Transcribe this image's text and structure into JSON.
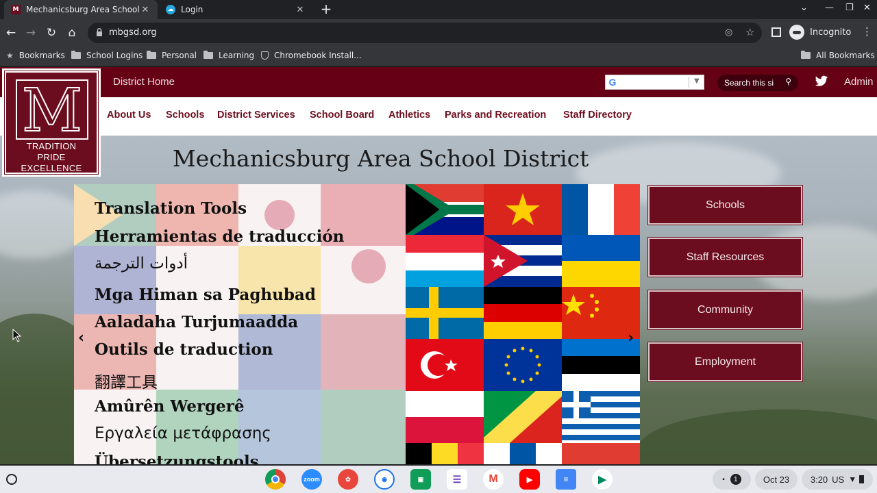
{
  "browser": {
    "tabs": [
      {
        "title": "Mechanicsburg Area School Dis",
        "active": true
      },
      {
        "title": "Login",
        "active": false
      }
    ],
    "new_tab": "+",
    "url": "mbgsd.org",
    "profile_label": "Incognito",
    "bookmarks": [
      {
        "label": "Bookmarks",
        "icon": "star-icon"
      },
      {
        "label": "School Logins",
        "icon": "folder-icon"
      },
      {
        "label": "Personal",
        "icon": "folder-icon"
      },
      {
        "label": "Learning",
        "icon": "folder-icon"
      },
      {
        "label": "Chromebook Install...",
        "icon": "shield-icon"
      }
    ],
    "all_bookmarks": "All Bookmarks"
  },
  "site": {
    "top_link": "District Home",
    "translate_g": "G",
    "search_placeholder": "Search this si",
    "admin_label": "Admin",
    "nav": [
      "About Us",
      "Schools",
      "District Services",
      "School Board",
      "Athletics",
      "Parks and Recreation",
      "Staff Directory"
    ],
    "logo": {
      "letter": "M",
      "motto": [
        "TRADITION",
        "PRIDE",
        "EXCELLENCE"
      ]
    },
    "title": "Mechanicsburg Area School District",
    "slide": {
      "lines": [
        "Translation Tools",
        "Herramientas de traducción",
        "أدوات الترجمة",
        "Mga Himan sa Paghubad",
        "Aaladaha Turjumaadda",
        "Outils de traduction",
        "翻譯工具",
        "Amûrên Wergerê",
        "Εργαλεία μετάφρασης",
        "Übersetzungstools"
      ],
      "prev": "‹",
      "next": "›"
    },
    "quick_links": [
      "Schools",
      "Staff Resources",
      "Community",
      "Employment"
    ],
    "colors": {
      "maroon": "#6b0d1e",
      "topbar": "#660014"
    }
  },
  "shelf": {
    "apps": [
      "Chrome",
      "zoom",
      "Canvas",
      "Screencastify",
      "Classroom",
      "Forms",
      "Gmail",
      "YouTube",
      "Docs",
      "Play Store"
    ],
    "notification_count": "1",
    "date": "Oct 23",
    "time": "3:20",
    "locale": "US"
  }
}
